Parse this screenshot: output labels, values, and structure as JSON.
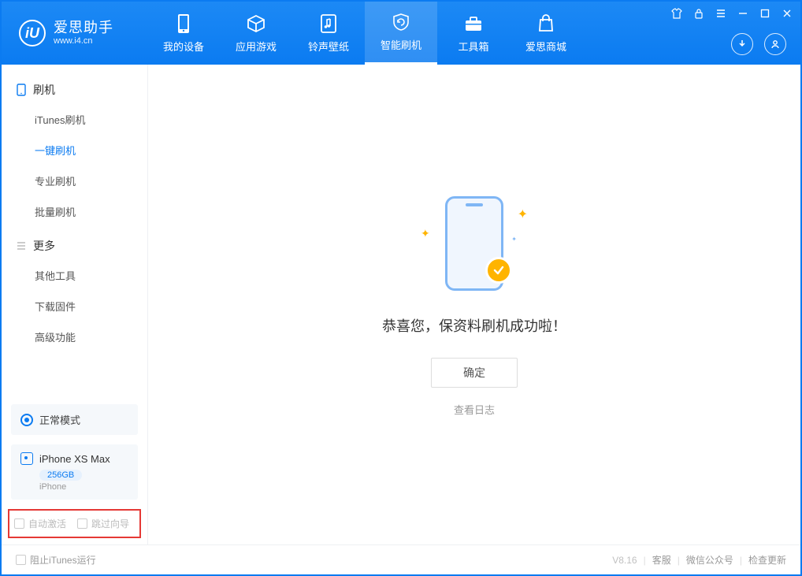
{
  "app": {
    "title": "爱思助手",
    "subtitle": "www.i4.cn"
  },
  "nav": {
    "tabs": [
      {
        "label": "我的设备"
      },
      {
        "label": "应用游戏"
      },
      {
        "label": "铃声壁纸"
      },
      {
        "label": "智能刷机"
      },
      {
        "label": "工具箱"
      },
      {
        "label": "爱思商城"
      }
    ]
  },
  "sidebar": {
    "sections": [
      {
        "title": "刷机",
        "items": [
          {
            "label": "iTunes刷机"
          },
          {
            "label": "一键刷机"
          },
          {
            "label": "专业刷机"
          },
          {
            "label": "批量刷机"
          }
        ]
      },
      {
        "title": "更多",
        "items": [
          {
            "label": "其他工具"
          },
          {
            "label": "下载固件"
          },
          {
            "label": "高级功能"
          }
        ]
      }
    ],
    "mode": "正常模式",
    "device": {
      "name": "iPhone XS Max",
      "storage": "256GB",
      "type": "iPhone"
    },
    "checkboxes": {
      "auto_activate": "自动激活",
      "skip_guide": "跳过向导"
    }
  },
  "main": {
    "success": "恭喜您，保资料刷机成功啦！",
    "ok": "确定",
    "view_log": "查看日志"
  },
  "status": {
    "block_itunes": "阻止iTunes运行",
    "version": "V8.16",
    "links": {
      "service": "客服",
      "wechat": "微信公众号",
      "update": "检查更新"
    }
  }
}
